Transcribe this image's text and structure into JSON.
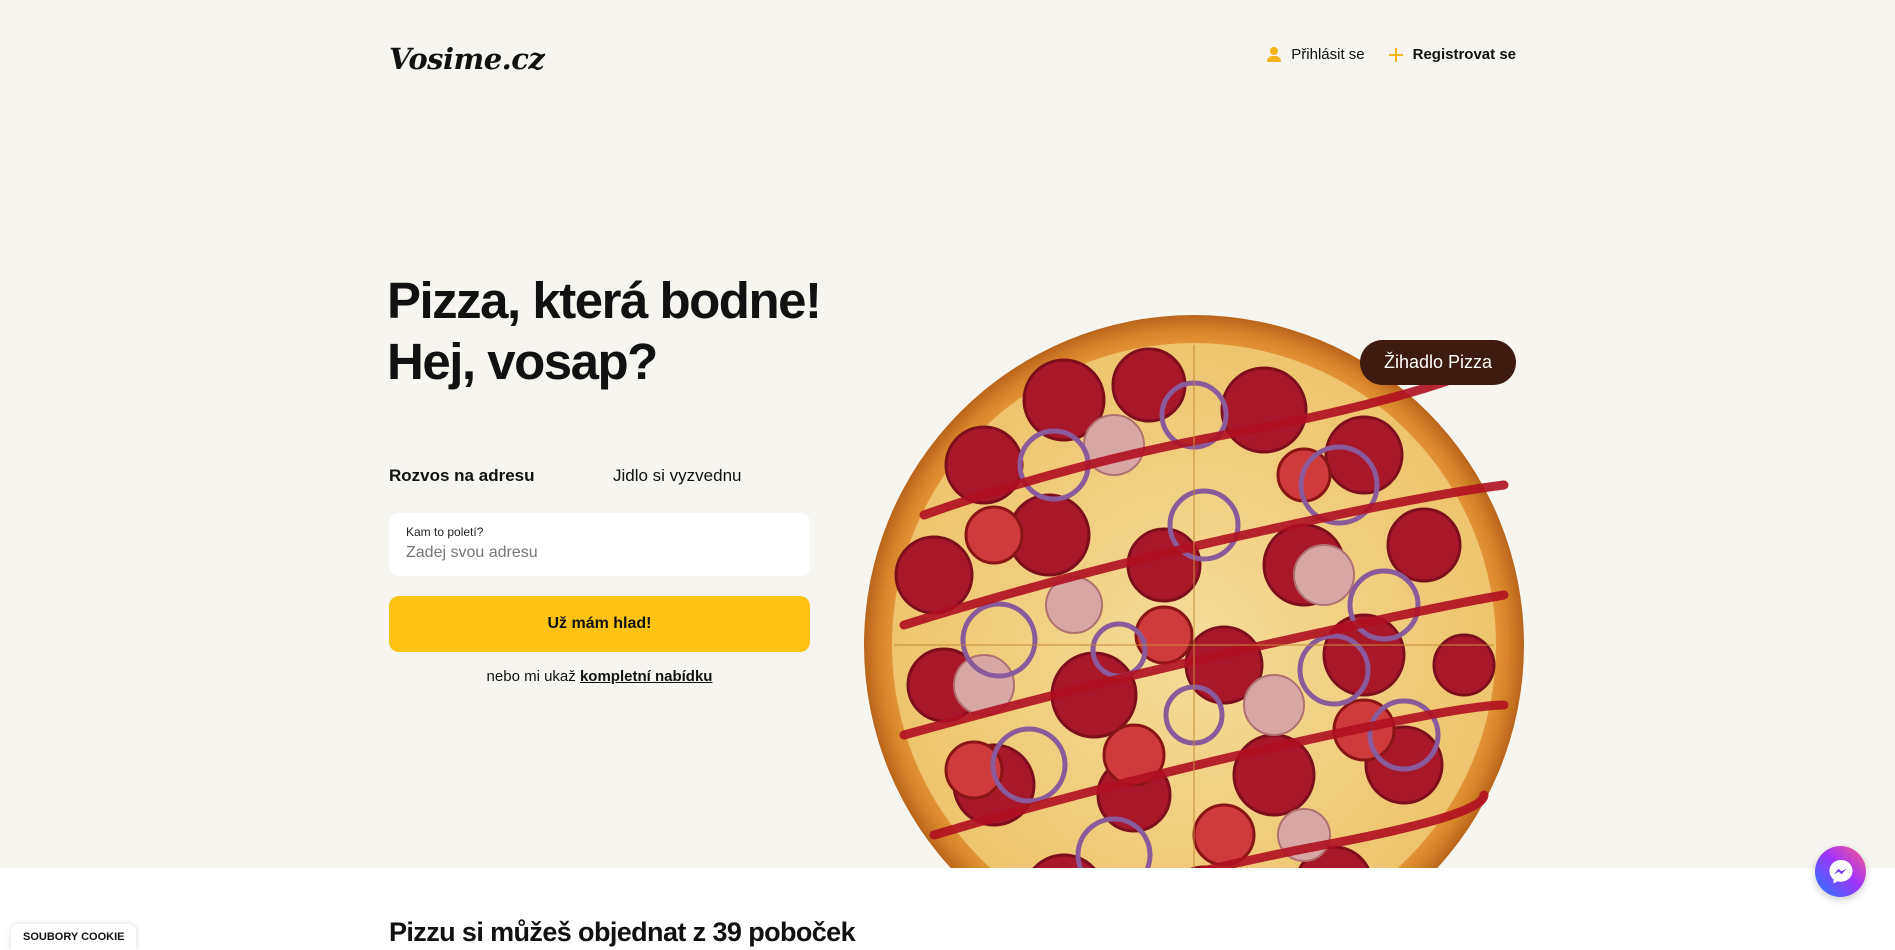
{
  "header": {
    "logo": "Vosime.cz",
    "login_label": "Přihlásit se",
    "register_label": "Registrovat se"
  },
  "hero": {
    "headline_line1": "Pizza, která bodne!",
    "headline_line2": "Hej, vosap?",
    "tabs": [
      {
        "label": "Rozvos na adresu",
        "active": true
      },
      {
        "label": "Jidlo si vyzvednu",
        "active": false
      }
    ],
    "address": {
      "label": "Kam to poletí?",
      "placeholder": "Zadej svou adresu",
      "value": ""
    },
    "cta_label": "Už mám hlad!",
    "alt_prefix": "nebo mi ukaž",
    "alt_link": "kompletní nabídku",
    "badge": "Žihadlo Pizza"
  },
  "branches": {
    "title": "Pizzu si můžeš objednat z 39 poboček"
  },
  "cookie": {
    "label": "SOUBORY COOKIE"
  },
  "icons": {
    "login": "user-icon",
    "register": "plus-icon",
    "chat": "messenger-icon"
  },
  "colors": {
    "accent": "#fdc214",
    "hero_bg": "#f7f5f0",
    "badge_bg": "#3e1a10"
  }
}
